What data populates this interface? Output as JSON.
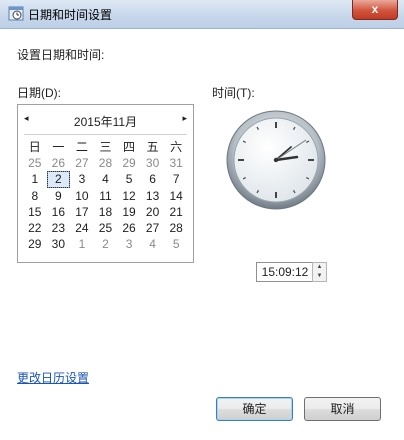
{
  "window": {
    "title": "日期和时间设置",
    "close_label": "x"
  },
  "heading": "设置日期和时间:",
  "date_label": "日期(D):",
  "time_label": "时间(T):",
  "calendar": {
    "month_title": "2015年11月",
    "prev_icon": "◂",
    "next_icon": "▸",
    "weekdays": [
      "日",
      "一",
      "二",
      "三",
      "四",
      "五",
      "六"
    ],
    "weeks": [
      [
        "25",
        "26",
        "27",
        "28",
        "29",
        "30",
        "31"
      ],
      [
        "1",
        "2",
        "3",
        "4",
        "5",
        "6",
        "7"
      ],
      [
        "8",
        "9",
        "10",
        "11",
        "12",
        "13",
        "14"
      ],
      [
        "15",
        "16",
        "17",
        "18",
        "19",
        "20",
        "21"
      ],
      [
        "22",
        "23",
        "24",
        "25",
        "26",
        "27",
        "28"
      ],
      [
        "29",
        "30",
        "1",
        "2",
        "3",
        "4",
        "5"
      ]
    ],
    "selected_day": "2"
  },
  "time_value": "15:09:12",
  "spin_up_icon": "▲",
  "spin_down_icon": "▼",
  "change_calendar_link": "更改日历设置",
  "buttons": {
    "ok": "确定",
    "cancel": "取消"
  }
}
